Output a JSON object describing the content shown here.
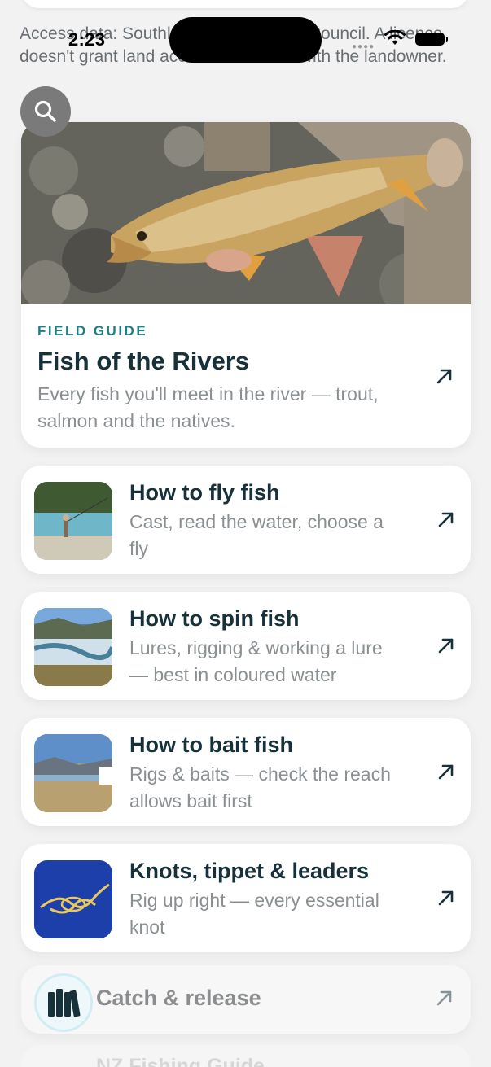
{
  "status_bar": {
    "time": "2:23"
  },
  "access_note": "Access data: Southland Fish & Game Council. A licence doesn't grant land access — confirm with the landowner.",
  "hero": {
    "eyebrow": "FIELD GUIDE",
    "title": "Fish of the Rivers",
    "description": "Every fish you'll meet in the river — trout, salmon and the natives."
  },
  "guides": [
    {
      "title": "How to fly fish",
      "description": "Cast, read the water, choose a fly"
    },
    {
      "title": "How to spin fish",
      "description": "Lures, rigging & working a lure — best in coloured water"
    },
    {
      "title": "How to bait fish",
      "description": "Rigs & baits — check the reach allows bait first"
    },
    {
      "title": "Knots, tippet & leaders",
      "description": "Rig up right — every essential knot"
    }
  ],
  "release": {
    "title": "Catch & release"
  },
  "footer": {
    "title": "NZ Fishing Guide"
  },
  "icons": [
    "search-icon",
    "arrow-up-right-icon",
    "library-books-icon",
    "wifi-icon",
    "battery-icon"
  ],
  "colors": {
    "accent": "#1f7f86",
    "title": "#17313a",
    "muted": "#8a8f92",
    "background": "#f2f2f2"
  }
}
